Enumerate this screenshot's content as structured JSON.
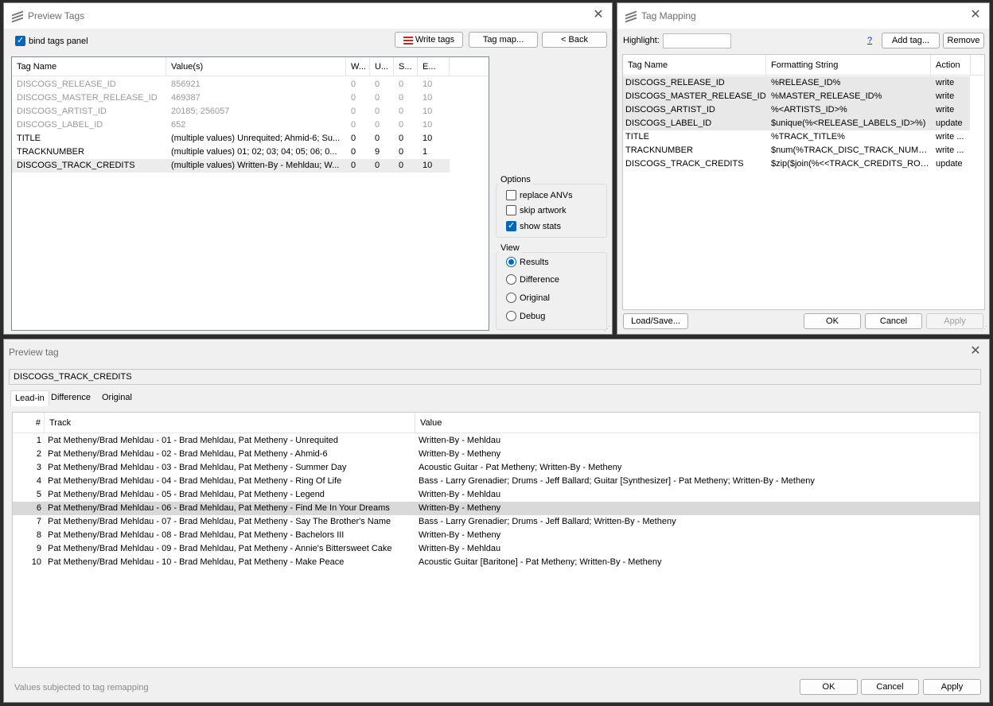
{
  "preview_tags": {
    "title": "Preview Tags",
    "bind_panel_label": "bind tags panel",
    "write_tags_label": "Write tags",
    "tag_map_label": "Tag map...",
    "back_label": "< Back",
    "columns": [
      "Tag Name",
      "Value(s)",
      "W...",
      "U...",
      "S...",
      "E..."
    ],
    "rows": [
      {
        "name": "DISCOGS_RELEASE_ID",
        "value": "856921",
        "w": "0",
        "u": "0",
        "s": "0",
        "e": "10"
      },
      {
        "name": "DISCOGS_MASTER_RELEASE_ID",
        "value": "469387",
        "w": "0",
        "u": "0",
        "s": "0",
        "e": "10"
      },
      {
        "name": "DISCOGS_ARTIST_ID",
        "value": "20185; 256057",
        "w": "0",
        "u": "0",
        "s": "0",
        "e": "10"
      },
      {
        "name": "DISCOGS_LABEL_ID",
        "value": "652",
        "w": "0",
        "u": "0",
        "s": "0",
        "e": "10"
      },
      {
        "name": "TITLE",
        "value": "(multiple values) Unrequited; Ahmid-6; Su...",
        "w": "0",
        "u": "0",
        "s": "0",
        "e": "10"
      },
      {
        "name": "TRACKNUMBER",
        "value": "(multiple values) 01; 02; 03; 04; 05; 06; 0...",
        "w": "0",
        "u": "9",
        "s": "0",
        "e": "1"
      },
      {
        "name": "DISCOGS_TRACK_CREDITS",
        "value": "(multiple values) Written-By - Mehldau; W...",
        "w": "0",
        "u": "0",
        "s": "0",
        "e": "10"
      }
    ],
    "options": {
      "label": "Options",
      "replace_anvs": "replace ANVs",
      "skip_artwork": "skip artwork",
      "show_stats": "show stats"
    },
    "view": {
      "label": "View",
      "results": "Results",
      "difference": "Difference",
      "original": "Original",
      "debug": "Debug"
    }
  },
  "tag_mapping": {
    "title": "Tag Mapping",
    "highlight_label": "Highlight:",
    "highlight_value": "",
    "help_label": "?",
    "add_tag_label": "Add tag...",
    "remove_label": "Remove",
    "columns": [
      "Tag Name",
      "Formatting String",
      "Action"
    ],
    "rows": [
      {
        "name": "DISCOGS_RELEASE_ID",
        "format": "%RELEASE_ID%",
        "action": "write"
      },
      {
        "name": "DISCOGS_MASTER_RELEASE_ID",
        "format": "%MASTER_RELEASE_ID%",
        "action": "write"
      },
      {
        "name": "DISCOGS_ARTIST_ID",
        "format": "%<ARTISTS_ID>%",
        "action": "write"
      },
      {
        "name": "DISCOGS_LABEL_ID",
        "format": "$unique(%<RELEASE_LABELS_ID>%)",
        "action": "update"
      },
      {
        "name": "TITLE",
        "format": "%TRACK_TITLE%",
        "action": "write ..."
      },
      {
        "name": "TRACKNUMBER",
        "format": "$num(%TRACK_DISC_TRACK_NUMBE...",
        "action": "write ..."
      },
      {
        "name": "DISCOGS_TRACK_CREDITS",
        "format": "$zip($join(%<<TRACK_CREDITS_ROL...",
        "action": "update"
      }
    ],
    "load_save_label": "Load/Save...",
    "ok_label": "OK",
    "cancel_label": "Cancel",
    "apply_label": "Apply"
  },
  "preview_tag": {
    "title": "Preview tag",
    "tag_name": "DISCOGS_TRACK_CREDITS",
    "tabs": [
      "Lead-in",
      "Difference",
      "Original"
    ],
    "columns": [
      "#",
      "Track",
      "Value"
    ],
    "rows": [
      {
        "n": "1",
        "track": "Pat Metheny/Brad Mehldau - 01 - Brad Mehldau, Pat Metheny - Unrequited",
        "value": "Written-By - Mehldau"
      },
      {
        "n": "2",
        "track": "Pat Metheny/Brad Mehldau - 02 - Brad Mehldau, Pat Metheny - Ahmid-6",
        "value": "Written-By - Metheny"
      },
      {
        "n": "3",
        "track": "Pat Metheny/Brad Mehldau - 03 - Brad Mehldau, Pat Metheny - Summer Day",
        "value": "Acoustic Guitar - Pat Metheny; Written-By - Metheny"
      },
      {
        "n": "4",
        "track": "Pat Metheny/Brad Mehldau - 04 - Brad Mehldau, Pat Metheny - Ring Of Life",
        "value": "Bass - Larry Grenadier; Drums - Jeff Ballard; Guitar [Synthesizer] - Pat Metheny; Written-By - Metheny"
      },
      {
        "n": "5",
        "track": "Pat Metheny/Brad Mehldau - 05 - Brad Mehldau, Pat Metheny - Legend",
        "value": "Written-By - Mehldau"
      },
      {
        "n": "6",
        "track": "Pat Metheny/Brad Mehldau - 06 - Brad Mehldau, Pat Metheny - Find Me In Your Dreams",
        "value": "Written-By - Metheny"
      },
      {
        "n": "7",
        "track": "Pat Metheny/Brad Mehldau - 07 - Brad Mehldau, Pat Metheny - Say The Brother's Name",
        "value": "Bass - Larry Grenadier; Drums - Jeff Ballard; Written-By - Metheny"
      },
      {
        "n": "8",
        "track": "Pat Metheny/Brad Mehldau - 08 - Brad Mehldau, Pat Metheny - Bachelors III",
        "value": "Written-By - Metheny"
      },
      {
        "n": "9",
        "track": "Pat Metheny/Brad Mehldau - 09 - Brad Mehldau, Pat Metheny - Annie's Bittersweet Cake",
        "value": "Written-By - Mehldau"
      },
      {
        "n": "10",
        "track": "Pat Metheny/Brad Mehldau - 10 - Brad Mehldau, Pat Metheny - Make Peace",
        "value": "Acoustic Guitar [Baritone] - Pat Metheny; Written-By - Metheny"
      }
    ],
    "status": "Values subjected to tag remapping",
    "ok_label": "OK",
    "cancel_label": "Cancel",
    "apply_label": "Apply"
  }
}
